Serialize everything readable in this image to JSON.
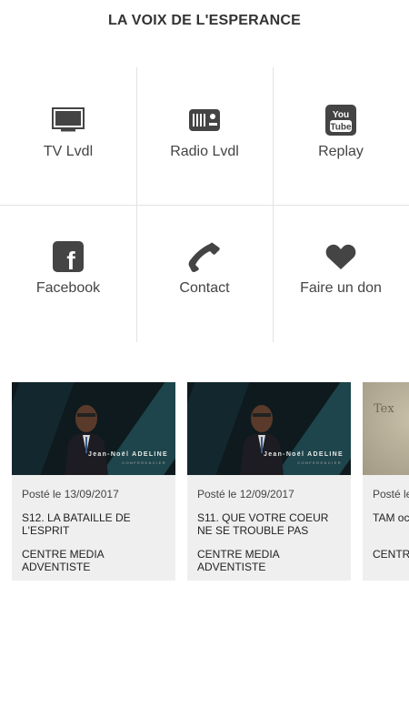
{
  "header": {
    "title": "LA VOIX DE L'ESPERANCE"
  },
  "menu": [
    {
      "label": "TV Lvdl",
      "icon": "tv-icon"
    },
    {
      "label": "Radio Lvdl",
      "icon": "radio-icon"
    },
    {
      "label": "Replay",
      "icon": "youtube-icon",
      "icon_text_top": "You",
      "icon_text_bottom": "Tube"
    },
    {
      "label": "Facebook",
      "icon": "facebook-icon",
      "icon_text": "f"
    },
    {
      "label": "Contact",
      "icon": "phone-icon"
    },
    {
      "label": "Faire un don",
      "icon": "heart-icon"
    }
  ],
  "cards": [
    {
      "date": "Posté le 13/09/2017",
      "title": "S12. LA BATAILLE DE L'ESPRIT",
      "source": "CENTRE MEDIA ADVENTISTE",
      "thumb_caption": "Jean-Noël ADELINE",
      "thumb_sub": "CONFERENCIER"
    },
    {
      "date": "Posté le 12/09/2017",
      "title": "S11. QUE VOTRE COEUR NE SE TROUBLE PAS",
      "source": "CENTRE MEDIA ADVENTISTE",
      "thumb_caption": "Jean-Noël ADELINE",
      "thumb_sub": "CONFERENCIER"
    },
    {
      "date": "Posté le",
      "title": "TAM oc",
      "source": "CENTRE",
      "thumb_script": "Tex"
    }
  ],
  "colors": {
    "icon": "#444444",
    "divider": "#e2e2e2",
    "card_bg": "#efefef"
  }
}
